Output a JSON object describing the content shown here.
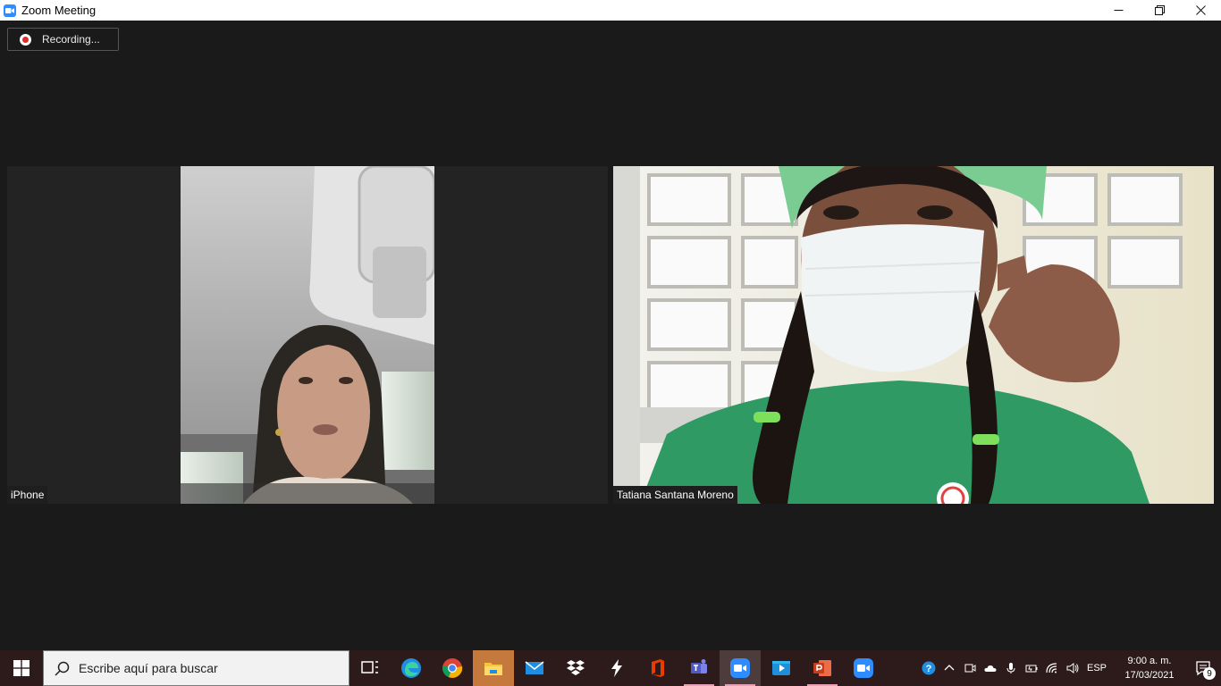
{
  "window": {
    "title": "Zoom Meeting",
    "controls": {
      "minimize": "minimize",
      "restore": "restore",
      "close": "close"
    }
  },
  "recording": {
    "label": "Recording..."
  },
  "participants": [
    {
      "name": "iPhone"
    },
    {
      "name": "Tatiana Santana Moreno"
    }
  ],
  "taskbar": {
    "search_placeholder": "Escribe aquí para buscar",
    "apps": [
      {
        "name": "task-view-icon"
      },
      {
        "name": "edge-icon"
      },
      {
        "name": "chrome-icon"
      },
      {
        "name": "file-explorer-icon"
      },
      {
        "name": "mail-icon"
      },
      {
        "name": "dropbox-icon"
      },
      {
        "name": "bolt-app-icon"
      },
      {
        "name": "office-icon"
      },
      {
        "name": "teams-icon"
      },
      {
        "name": "zoom-icon"
      },
      {
        "name": "video-editor-icon"
      },
      {
        "name": "powerpoint-icon"
      },
      {
        "name": "zoom-icon"
      }
    ],
    "tray": {
      "language": "ESP",
      "time": "9:00 a. m.",
      "date": "17/03/2021",
      "notification_count": "9"
    }
  },
  "colors": {
    "background": "#1a1a1a",
    "taskbar": "#2d1b1b",
    "zoom_blue": "#2d8cff",
    "recording_red": "#e02b2b"
  }
}
